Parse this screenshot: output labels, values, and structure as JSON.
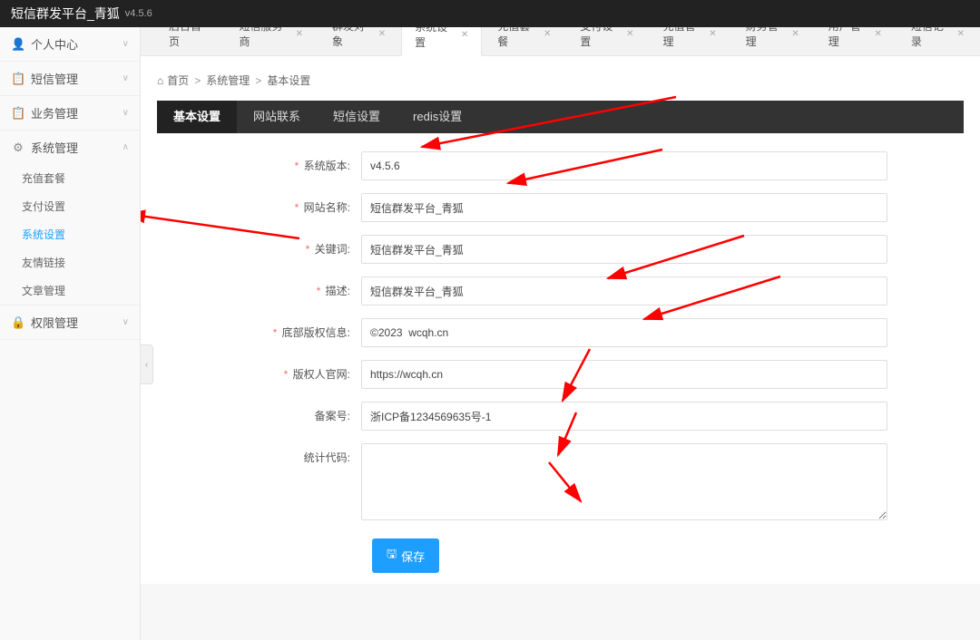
{
  "header": {
    "title": "短信群发平台_青狐",
    "version": "v4.5.6"
  },
  "sidebar": {
    "items": [
      {
        "icon": "👤",
        "label": "个人中心",
        "expanded": false
      },
      {
        "icon": "📋",
        "label": "短信管理",
        "expanded": false
      },
      {
        "icon": "📋",
        "label": "业务管理",
        "expanded": false
      },
      {
        "icon": "⚙",
        "label": "系统管理",
        "expanded": true,
        "children": [
          {
            "label": "充值套餐"
          },
          {
            "label": "支付设置"
          },
          {
            "label": "系统设置",
            "active": true
          },
          {
            "label": "友情链接"
          },
          {
            "label": "文章管理"
          }
        ]
      },
      {
        "icon": "🔒",
        "label": "权限管理",
        "expanded": false
      }
    ]
  },
  "tabs": [
    {
      "label": "后台首页",
      "closable": false
    },
    {
      "label": "短信服务商",
      "closable": true
    },
    {
      "label": "群发对象",
      "closable": true
    },
    {
      "label": "系统设置",
      "closable": true,
      "active": true
    },
    {
      "label": "充值套餐",
      "closable": true
    },
    {
      "label": "支付设置",
      "closable": true
    },
    {
      "label": "充值管理",
      "closable": true
    },
    {
      "label": "财务管理",
      "closable": true
    },
    {
      "label": "用户管理",
      "closable": true
    },
    {
      "label": "短信记录",
      "closable": true
    }
  ],
  "breadcrumb": {
    "home": "首页",
    "parts": [
      "系统管理",
      "基本设置"
    ]
  },
  "innerTabs": [
    {
      "label": "基本设置",
      "active": true
    },
    {
      "label": "网站联系"
    },
    {
      "label": "短信设置"
    },
    {
      "label": "redis设置"
    }
  ],
  "form": {
    "fields": [
      {
        "label": "系统版本:",
        "value": "v4.5.6",
        "required": true
      },
      {
        "label": "网站名称:",
        "value": "短信群发平台_青狐",
        "required": true
      },
      {
        "label": "关键词:",
        "value": "短信群发平台_青狐",
        "required": true
      },
      {
        "label": "描述:",
        "value": "短信群发平台_青狐",
        "required": true
      },
      {
        "label": "底部版权信息:",
        "value": "©2023  wcqh.cn",
        "required": true
      },
      {
        "label": "版权人官网:",
        "value": "https://wcqh.cn",
        "required": true
      },
      {
        "label": "备案号:",
        "value": "浙ICP备1234569635号-1",
        "required": false
      },
      {
        "label": "统计代码:",
        "value": "",
        "required": false,
        "textarea": true
      }
    ],
    "saveLabel": "保存"
  }
}
